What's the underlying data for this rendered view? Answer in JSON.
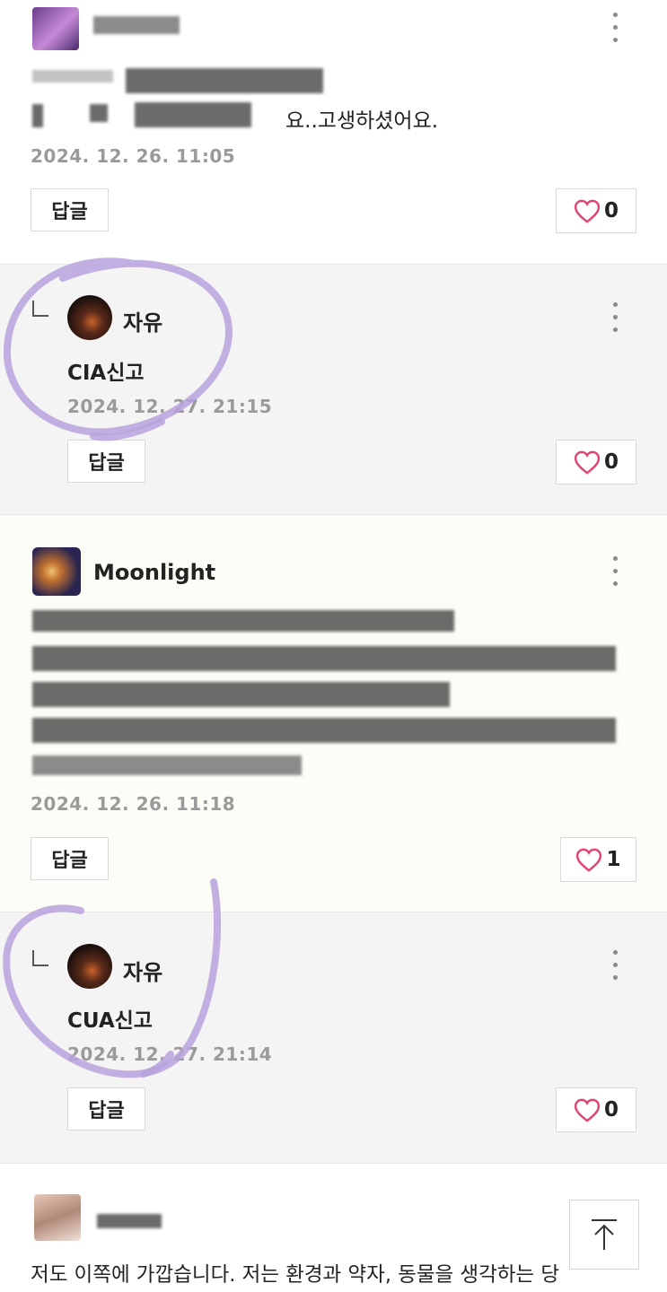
{
  "colors": {
    "heart": "#e0456f",
    "date": "#9a9a9a",
    "marker": "#b7a2dd"
  },
  "comments": [
    {
      "nickname": "",
      "text_visible": "요..고생하셨어요.",
      "date": "2024. 12. 26. 11:05",
      "reply_label": "답글",
      "likes": "0"
    },
    {
      "nickname": "자유",
      "text": "CIA신고",
      "date": "2024. 12. 27. 21:15",
      "reply_label": "답글",
      "likes": "0"
    },
    {
      "nickname": "Moonlight",
      "date": "2024. 12. 26. 11:18",
      "reply_label": "답글",
      "likes": "1"
    },
    {
      "nickname": "자유",
      "text": "CUA신고",
      "date": "2024. 12. 27. 21:14",
      "reply_label": "답글",
      "likes": "0"
    },
    {
      "nickname": "",
      "text": "저도 이쪽에 가깝습니다. 저는 환경과 약자, 동물을 생각하는 당"
    }
  ],
  "icons": {
    "more": "more-vertical-icon",
    "heart": "heart-icon",
    "scroll_top": "arrow-up-icon"
  }
}
